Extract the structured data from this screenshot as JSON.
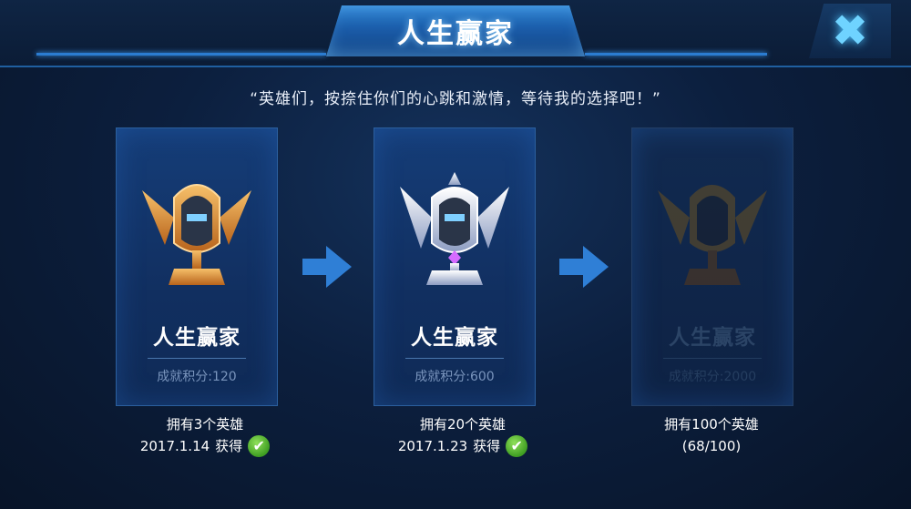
{
  "header": {
    "title": "人生赢家",
    "close_icon": "close-x-icon"
  },
  "quote": "“英雄们，按捺住你们的心跳和激情，等待我的选择吧！”",
  "achievements": [
    {
      "title": "人生赢家",
      "score": "成就积分:120",
      "tier": "bronze",
      "badge_color": "#e0913a",
      "requirement": "拥有3个英雄",
      "date": "2017.1.14",
      "status": "获得",
      "completed": true
    },
    {
      "title": "人生赢家",
      "score": "成就积分:600",
      "tier": "silver",
      "badge_color": "#c9d4ef",
      "requirement": "拥有20个英雄",
      "date": "2017.1.23",
      "status": "获得",
      "completed": true
    },
    {
      "title": "人生赢家",
      "score": "成就积分:2000",
      "tier": "gold",
      "badge_color": "#6a5020",
      "requirement": "拥有100个英雄",
      "progress": "(68/100)",
      "completed": false
    }
  ],
  "colors": {
    "accent": "#2b7cd1",
    "check": "#5cbf2a",
    "background": "#0c1f3e"
  }
}
